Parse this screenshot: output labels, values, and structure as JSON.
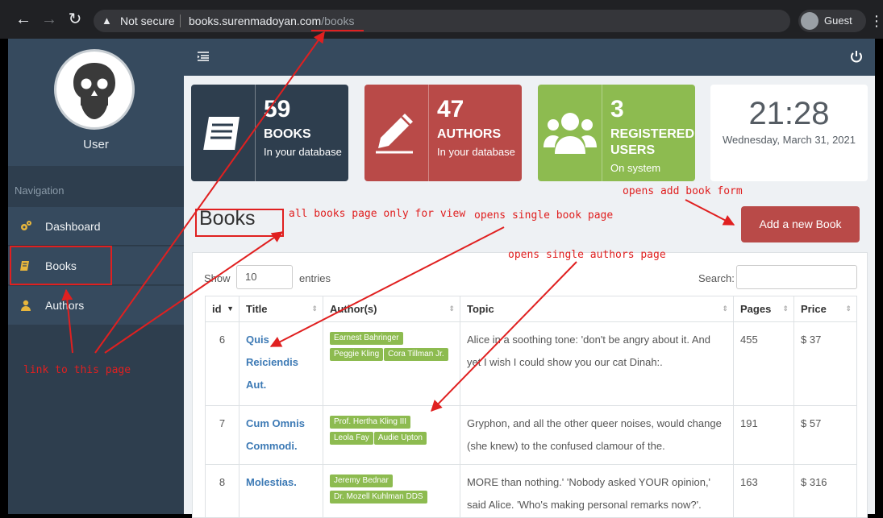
{
  "browser": {
    "security_warning": "Not secure",
    "url_host": "books.surenmadoyan.com",
    "url_path": "/books",
    "profile_name": "Guest"
  },
  "sidebar": {
    "username": "User",
    "nav_heading": "Navigation",
    "items": [
      {
        "label": "Dashboard",
        "icon": "gears-icon"
      },
      {
        "label": "Books",
        "icon": "book-icon"
      },
      {
        "label": "Authors",
        "icon": "user-icon"
      }
    ]
  },
  "stats": [
    {
      "number": "59",
      "title": "BOOKS",
      "subtitle": "In your database",
      "icon": "book-icon",
      "color": "#2e3e4e"
    },
    {
      "number": "47",
      "title": "AUTHORS",
      "subtitle": "In your database",
      "icon": "pencil-icon",
      "color": "#b94a48"
    },
    {
      "number": "3",
      "title": "REGISTERED USERS",
      "subtitle": "On system",
      "icon": "users-icon",
      "color": "#8dbb50"
    }
  ],
  "clock": {
    "time": "21:28",
    "date": "Wednesday, March 31, 2021"
  },
  "page": {
    "title": "Books",
    "add_button": "Add a new Book"
  },
  "table": {
    "show_label": "Show",
    "length_value": "10",
    "entries_label": "entries",
    "search_label": "Search:",
    "columns": [
      "id",
      "Title",
      "Author(s)",
      "Topic",
      "Pages",
      "Price"
    ],
    "rows": [
      {
        "id": "6",
        "title": "Quis Reiciendis Aut.",
        "authors": [
          "Earnest Bahringer",
          "Peggie Kling",
          "Cora Tillman Jr."
        ],
        "topic": "Alice in a soothing tone: 'don't be angry about it. And yet I wish I could show you our cat Dinah:.",
        "pages": "455",
        "price": "$ 37"
      },
      {
        "id": "7",
        "title": "Cum Omnis Commodi.",
        "authors": [
          "Prof. Hertha Kling III",
          "Leola Fay",
          "Audie Upton"
        ],
        "topic": "Gryphon, and all the other queer noises, would change (she knew) to the confused clamour of the.",
        "pages": "191",
        "price": "$ 57"
      },
      {
        "id": "8",
        "title": "Molestias.",
        "authors": [
          "Jeremy Bednar",
          "Dr. Mozell Kuhlman DDS"
        ],
        "topic": "MORE than nothing.' 'Nobody asked YOUR opinion,' said Alice. 'Who's making personal remarks now?'.",
        "pages": "163",
        "price": "$ 316"
      }
    ]
  },
  "annotations": {
    "link_to_page": "link to this page",
    "books_view": "all books page only for view",
    "single_book": "opens single book page",
    "single_author": "opens single authors page",
    "add_form": "opens add book form"
  },
  "colors": {
    "annotation": "#e02020",
    "accent_red": "#b94a48",
    "accent_green": "#8dbb50",
    "sidebar": "#2e3e4e"
  }
}
